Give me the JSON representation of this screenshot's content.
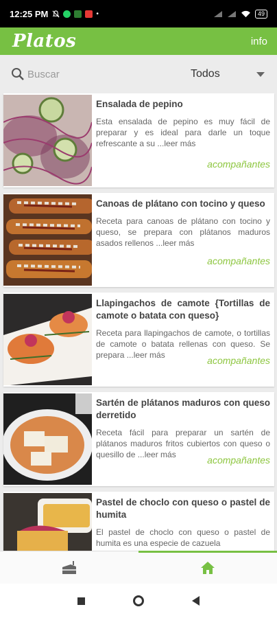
{
  "status": {
    "time": "12:25 PM",
    "battery": "49"
  },
  "appbar": {
    "title": "Platos",
    "info_label": "info"
  },
  "search": {
    "placeholder": "Buscar",
    "value": ""
  },
  "filter": {
    "selected": "Todos"
  },
  "recipes": [
    {
      "title": "Ensalada de pepino",
      "desc": "Esta ensalada de pepino es muy fácil de preparar y es ideal para darle un toque refrescante a su  ...leer más",
      "category": "acompañantes"
    },
    {
      "title": "Canoas de plátano con tocino y queso",
      "desc": "Receta para canoas de plátano con tocino y queso, se prepara con plátanos maduros asados rellenos ...leer más",
      "category": "acompañantes"
    },
    {
      "title": "Llapingachos de camote {Tortillas de camote o batata con queso}",
      "desc": "Receta para llapingachos de camote, o tortillas de camote o batata rellenas con queso. Se prepara ...leer más",
      "category": "acompañantes"
    },
    {
      "title": "Sartén de plátanos maduros con queso derretido",
      "desc": "Receta fácil para preparar un sartén de plátanos maduros fritos cubiertos con queso o quesillo de ...leer más",
      "category": "acompañantes"
    },
    {
      "title": "Pastel de choclo con queso o pastel de humita",
      "desc": "El pastel de choclo con queso o pastel de humita es una especie de cazuela",
      "category": ""
    }
  ],
  "colors": {
    "accent": "#77c043",
    "category": "#8dc63f"
  },
  "icons": {
    "nav_left": "cake-icon",
    "nav_right": "home-icon"
  }
}
